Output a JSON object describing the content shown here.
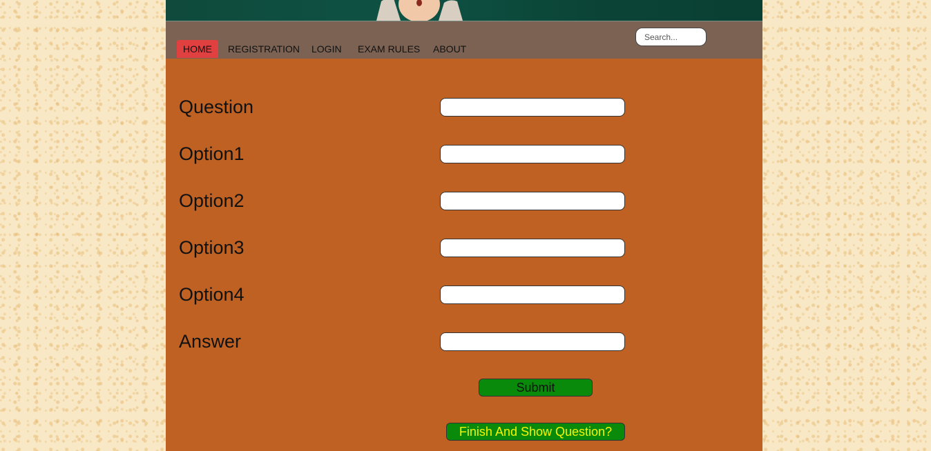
{
  "nav": {
    "items": [
      {
        "label": "HOME",
        "active": true
      },
      {
        "label": "REGISTRATION",
        "active": false
      },
      {
        "label": "LOGIN",
        "active": false
      },
      {
        "label": "EXAM RULES",
        "active": false
      },
      {
        "label": "ABOUT",
        "active": false
      }
    ],
    "active_color": "#e04040",
    "bar_color": "#7b6252"
  },
  "search": {
    "placeholder": "Search...",
    "value": ""
  },
  "form": {
    "fields": [
      {
        "label": "Question",
        "value": ""
      },
      {
        "label": "Option1",
        "value": ""
      },
      {
        "label": "Option2",
        "value": ""
      },
      {
        "label": "Option3",
        "value": ""
      },
      {
        "label": "Option4",
        "value": ""
      },
      {
        "label": "Answer",
        "value": ""
      }
    ],
    "submit_label": "Submit",
    "finish_label": "Finish And Show Question?"
  },
  "colors": {
    "page_background": "#bf6123",
    "button_green": "#0a8a0a",
    "finish_text": "#f5f500"
  }
}
